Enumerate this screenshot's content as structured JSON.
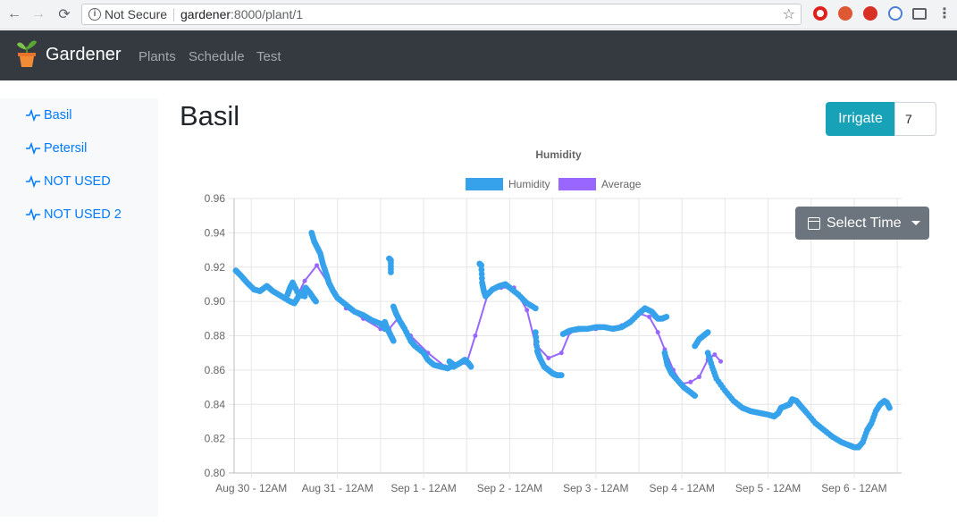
{
  "browser": {
    "security_label": "Not Secure",
    "url_host": "gardener",
    "url_rest": ":8000/plant/1"
  },
  "navbar": {
    "brand": "Gardener",
    "links": [
      "Plants",
      "Schedule",
      "Test"
    ]
  },
  "sidebar": {
    "items": [
      {
        "label": "Basil"
      },
      {
        "label": "Petersil"
      },
      {
        "label": "NOT USED"
      },
      {
        "label": "NOT USED 2"
      }
    ]
  },
  "main": {
    "title": "Basil",
    "irrigate_label": "Irrigate",
    "irrigate_value": "7",
    "select_time_label": "Select Time"
  },
  "colors": {
    "humidity": "#36a2eb",
    "average": "#9966ff",
    "irrigate": "#17a2b8",
    "navbar": "#343a40"
  },
  "chart_data": {
    "type": "scatter",
    "title": "Humidity",
    "legend": [
      "Humidity",
      "Average"
    ],
    "legend_position": "top",
    "x_tick_labels": [
      "Aug 30 - 12AM",
      "Aug 31 - 12AM",
      "Sep 1 - 12AM",
      "Sep 2 - 12AM",
      "Sep 3 - 12AM",
      "Sep 4 - 12AM",
      "Sep 5 - 12AM",
      "Sep 6 - 12AM"
    ],
    "y_tick_labels": [
      "0.80",
      "0.82",
      "0.84",
      "0.86",
      "0.88",
      "0.90",
      "0.92",
      "0.94",
      "0.96"
    ],
    "ylim": [
      0.8,
      0.96
    ],
    "x_unit": "days since Aug 30 12AM",
    "xlim": [
      -0.2,
      7.55
    ],
    "grid": true,
    "series": [
      {
        "name": "Humidity",
        "kind": "points",
        "points": [
          [
            -0.18,
            0.918
          ],
          [
            -0.12,
            0.915
          ],
          [
            -0.05,
            0.911
          ],
          [
            0.03,
            0.907
          ],
          [
            0.1,
            0.906
          ],
          [
            0.18,
            0.909
          ],
          [
            0.25,
            0.906
          ],
          [
            0.35,
            0.903
          ],
          [
            0.45,
            0.9
          ],
          [
            0.5,
            0.899
          ],
          [
            0.55,
            0.903
          ],
          [
            0.42,
            0.904
          ],
          [
            0.45,
            0.908
          ],
          [
            0.48,
            0.911
          ],
          [
            0.55,
            0.904
          ],
          [
            0.62,
            0.903
          ],
          [
            0.6,
            0.905
          ],
          [
            0.63,
            0.908
          ],
          [
            0.68,
            0.905
          ],
          [
            0.72,
            0.902
          ],
          [
            0.75,
            0.9
          ],
          [
            0.7,
            0.94
          ],
          [
            0.73,
            0.935
          ],
          [
            0.76,
            0.932
          ],
          [
            0.8,
            0.928
          ],
          [
            0.83,
            0.922
          ],
          [
            0.87,
            0.916
          ],
          [
            0.9,
            0.911
          ],
          [
            0.95,
            0.906
          ],
          [
            1.0,
            0.902
          ],
          [
            1.1,
            0.898
          ],
          [
            1.2,
            0.894
          ],
          [
            1.3,
            0.892
          ],
          [
            1.4,
            0.889
          ],
          [
            1.5,
            0.887
          ],
          [
            1.55,
            0.884
          ],
          [
            1.55,
            0.888
          ],
          [
            1.58,
            0.884
          ],
          [
            1.6,
            0.882
          ],
          [
            1.63,
            0.879
          ],
          [
            1.65,
            0.877
          ],
          [
            1.6,
            0.925
          ],
          [
            1.62,
            0.924
          ],
          [
            1.62,
            0.917
          ],
          [
            1.65,
            0.897
          ],
          [
            1.68,
            0.893
          ],
          [
            1.72,
            0.889
          ],
          [
            1.78,
            0.884
          ],
          [
            1.85,
            0.877
          ],
          [
            1.9,
            0.874
          ],
          [
            2.0,
            0.87
          ],
          [
            2.05,
            0.866
          ],
          [
            2.12,
            0.863
          ],
          [
            2.2,
            0.862
          ],
          [
            2.28,
            0.861
          ],
          [
            2.35,
            0.863
          ],
          [
            2.3,
            0.865
          ],
          [
            2.35,
            0.862
          ],
          [
            2.42,
            0.864
          ],
          [
            2.48,
            0.866
          ],
          [
            2.52,
            0.864
          ],
          [
            2.55,
            0.862
          ],
          [
            2.65,
            0.922
          ],
          [
            2.67,
            0.921
          ],
          [
            2.68,
            0.911
          ],
          [
            2.7,
            0.906
          ],
          [
            2.72,
            0.903
          ],
          [
            2.8,
            0.907
          ],
          [
            2.88,
            0.909
          ],
          [
            2.95,
            0.91
          ],
          [
            3.0,
            0.908
          ],
          [
            3.1,
            0.904
          ],
          [
            3.2,
            0.899
          ],
          [
            3.3,
            0.896
          ],
          [
            3.3,
            0.882
          ],
          [
            3.32,
            0.871
          ],
          [
            3.35,
            0.867
          ],
          [
            3.4,
            0.862
          ],
          [
            3.45,
            0.86
          ],
          [
            3.5,
            0.858
          ],
          [
            3.55,
            0.857
          ],
          [
            3.6,
            0.857
          ],
          [
            3.62,
            0.881
          ],
          [
            3.7,
            0.883
          ],
          [
            3.8,
            0.884
          ],
          [
            3.9,
            0.884
          ],
          [
            4.0,
            0.885
          ],
          [
            4.1,
            0.885
          ],
          [
            4.2,
            0.884
          ],
          [
            4.3,
            0.885
          ],
          [
            4.4,
            0.888
          ],
          [
            4.5,
            0.893
          ],
          [
            4.57,
            0.896
          ],
          [
            4.65,
            0.894
          ],
          [
            4.7,
            0.891
          ],
          [
            4.68,
            0.892
          ],
          [
            4.72,
            0.89
          ],
          [
            4.77,
            0.89
          ],
          [
            4.82,
            0.891
          ],
          [
            4.8,
            0.87
          ],
          [
            4.83,
            0.863
          ],
          [
            4.88,
            0.858
          ],
          [
            4.95,
            0.854
          ],
          [
            5.02,
            0.85
          ],
          [
            5.1,
            0.847
          ],
          [
            5.15,
            0.845
          ],
          [
            5.15,
            0.874
          ],
          [
            5.2,
            0.878
          ],
          [
            5.25,
            0.88
          ],
          [
            5.3,
            0.882
          ],
          [
            5.3,
            0.87
          ],
          [
            5.35,
            0.862
          ],
          [
            5.4,
            0.855
          ],
          [
            5.5,
            0.848
          ],
          [
            5.6,
            0.842
          ],
          [
            5.7,
            0.838
          ],
          [
            5.8,
            0.836
          ],
          [
            5.9,
            0.835
          ],
          [
            6.0,
            0.834
          ],
          [
            6.07,
            0.833
          ],
          [
            6.12,
            0.835
          ],
          [
            6.15,
            0.838
          ],
          [
            6.2,
            0.839
          ],
          [
            6.25,
            0.84
          ],
          [
            6.28,
            0.843
          ],
          [
            6.33,
            0.842
          ],
          [
            6.38,
            0.839
          ],
          [
            6.45,
            0.835
          ],
          [
            6.55,
            0.829
          ],
          [
            6.65,
            0.825
          ],
          [
            6.75,
            0.821
          ],
          [
            6.85,
            0.818
          ],
          [
            6.95,
            0.816
          ],
          [
            7.0,
            0.815
          ],
          [
            7.05,
            0.815
          ],
          [
            7.1,
            0.818
          ],
          [
            7.15,
            0.825
          ],
          [
            7.2,
            0.829
          ],
          [
            7.25,
            0.836
          ],
          [
            7.3,
            0.84
          ],
          [
            7.35,
            0.842
          ],
          [
            7.38,
            0.841
          ],
          [
            7.41,
            0.838
          ]
        ]
      },
      {
        "name": "Average",
        "kind": "line",
        "points": [
          [
            0.5,
            0.9
          ],
          [
            0.62,
            0.912
          ],
          [
            0.76,
            0.921
          ],
          [
            0.9,
            0.91
          ],
          [
            1.1,
            0.896
          ],
          [
            1.3,
            0.89
          ],
          [
            1.5,
            0.884
          ],
          [
            1.6,
            0.884
          ],
          [
            1.7,
            0.89
          ],
          [
            1.85,
            0.88
          ],
          [
            2.05,
            0.87
          ],
          [
            2.25,
            0.862
          ],
          [
            2.5,
            0.864
          ],
          [
            2.6,
            0.88
          ],
          [
            2.75,
            0.905
          ],
          [
            2.9,
            0.908
          ],
          [
            3.05,
            0.908
          ],
          [
            3.2,
            0.895
          ],
          [
            3.3,
            0.875
          ],
          [
            3.45,
            0.867
          ],
          [
            3.6,
            0.87
          ],
          [
            3.7,
            0.882
          ],
          [
            4.0,
            0.884
          ],
          [
            4.3,
            0.886
          ],
          [
            4.5,
            0.893
          ],
          [
            4.62,
            0.891
          ],
          [
            4.72,
            0.882
          ],
          [
            4.8,
            0.872
          ],
          [
            4.9,
            0.86
          ],
          [
            5.0,
            0.852
          ],
          [
            5.1,
            0.853
          ],
          [
            5.2,
            0.856
          ],
          [
            5.3,
            0.866
          ],
          [
            5.38,
            0.869
          ],
          [
            5.45,
            0.865
          ]
        ]
      },
      {
        "name": "Average",
        "kind": "line",
        "points": [
          [
            6.95,
            0.816
          ],
          [
            7.05,
            0.816
          ],
          [
            7.12,
            0.82
          ]
        ]
      }
    ]
  }
}
